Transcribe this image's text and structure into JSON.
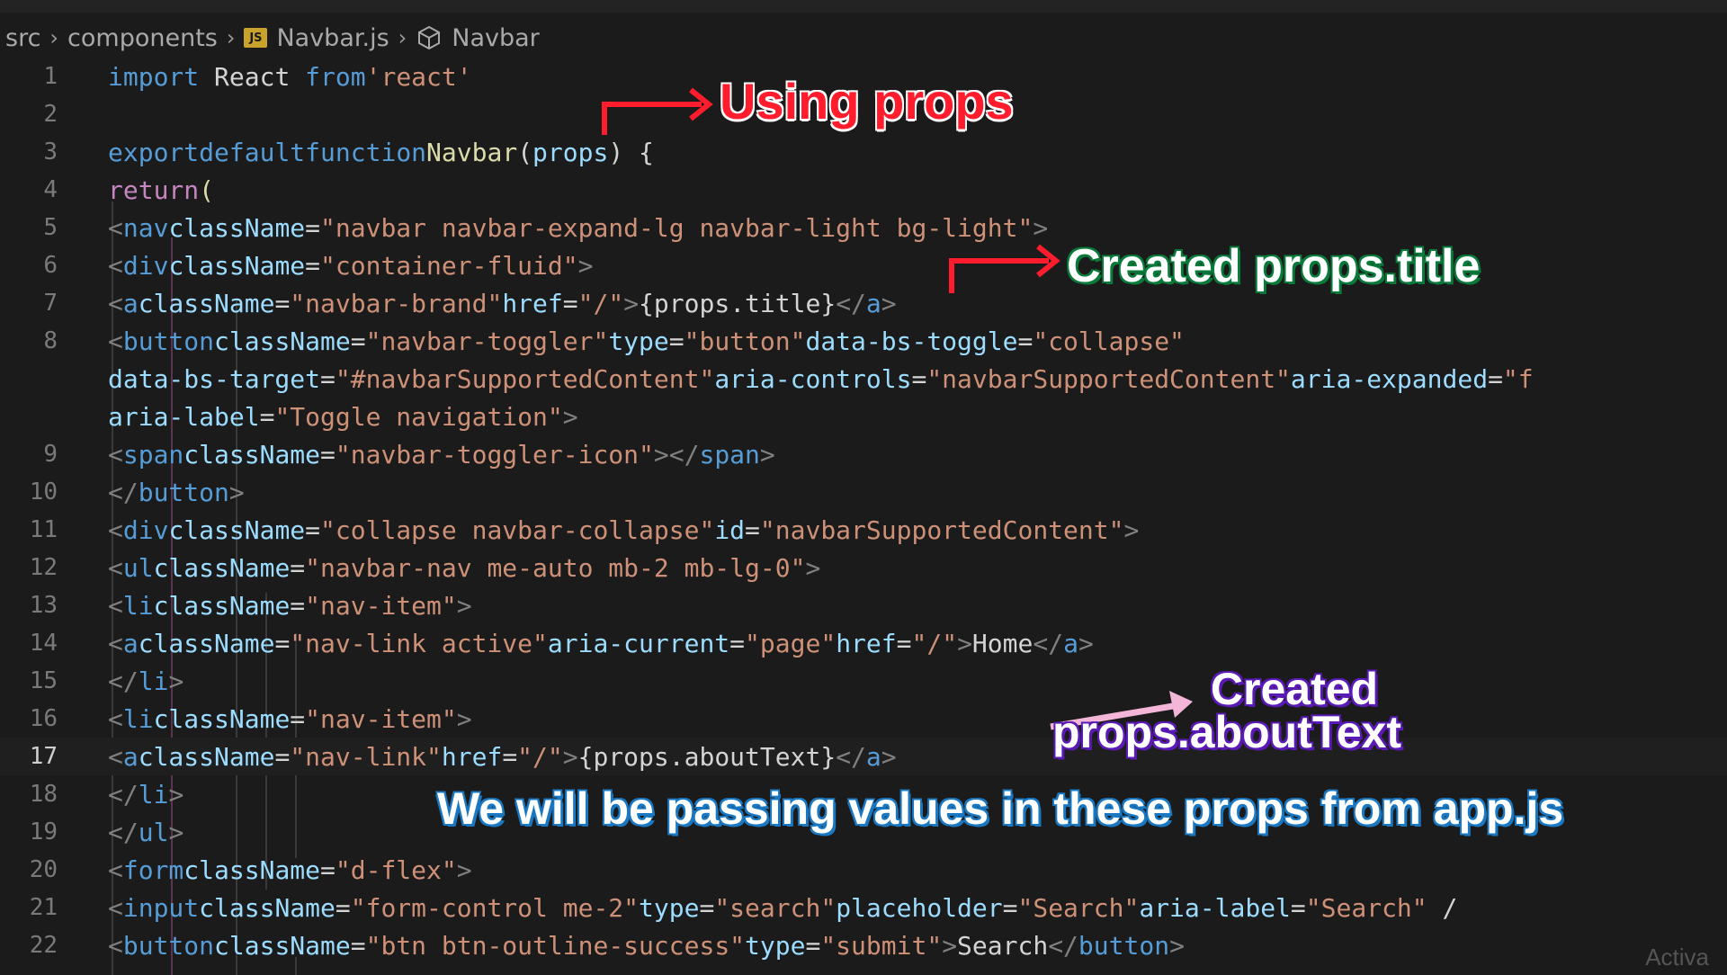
{
  "breadcrumb": {
    "items": [
      "src",
      "components",
      "Navbar.js",
      "Navbar"
    ],
    "js_icon_label": "JS"
  },
  "editor": {
    "line_numbers": [
      "1",
      "2",
      "3",
      "4",
      "5",
      "6",
      "7",
      "8",
      "9",
      "10",
      "11",
      "12",
      "13",
      "14",
      "15",
      "16",
      "17",
      "18",
      "19",
      "20",
      "21",
      "22"
    ],
    "current_line": "17"
  },
  "annotations": {
    "using_props": "Using props",
    "created_title": "Created props.title",
    "created_about_1": "Created",
    "created_about_2": "props.aboutText",
    "caption": "We will be passing values in these props from app.js"
  },
  "watermark": "Activa",
  "colors": {
    "red_arrow": "#ff1c2c",
    "pink_arrow": "#f3b6d8",
    "keyword": "#569cd6",
    "string": "#ce9178",
    "attribute": "#9cdcfe"
  }
}
